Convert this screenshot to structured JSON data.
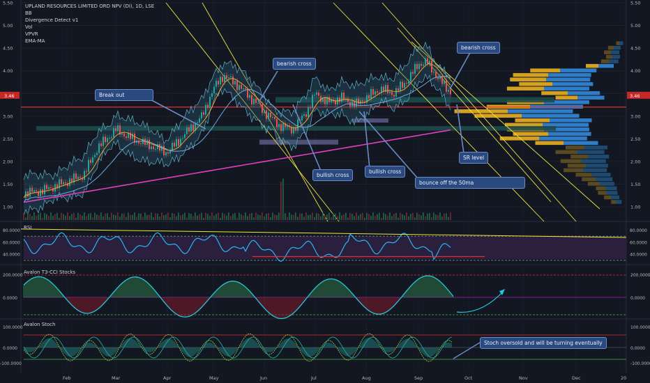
{
  "header": {
    "title": "UPLAND RESOURCES LIMITED ORD NPV (DI), 1D, LSE",
    "indicators": [
      "BB",
      "Divergence Detect v1",
      "Vol",
      "VPVR",
      "EMA-MA"
    ]
  },
  "panels": {
    "rsi_title": "RSI",
    "t3_title": "Avalon T3-CCI Stocks",
    "stoch_title": "Avalon Stoch"
  },
  "annotations": [
    {
      "id": "break-out",
      "text": "Break out"
    },
    {
      "id": "bearish-cross-1",
      "text": "bearish cross"
    },
    {
      "id": "bearish-cross-2",
      "text": "bearish cross"
    },
    {
      "id": "bullish-cross-1",
      "text": "bullish cross"
    },
    {
      "id": "bullish-cross-2",
      "text": "bullish cross"
    },
    {
      "id": "bounce-50ma",
      "text": "bounce off the 50ma"
    },
    {
      "id": "sr-level",
      "text": "SR level"
    },
    {
      "id": "stoch-note",
      "text": "Stoch oversold and will be turning eventually"
    }
  ],
  "colors": {
    "background": "#131722",
    "price_line": "#d1d4dc",
    "up_candle": "#26a69a",
    "down_candle": "#ef5350",
    "trend_yellow": "#f0e442",
    "ma_magenta": "#e040c0",
    "ema_orange": "#f0a030",
    "ma_blue": "#6fa8dc",
    "support_red": "#e03030",
    "rsi_line": "#29b6f6",
    "note_fill": "#2a4a7f"
  },
  "chart_data": {
    "type": "line",
    "x_ticks": [
      "Feb",
      "Mar",
      "Apr",
      "May",
      "Jun",
      "Jul",
      "Aug",
      "Sep",
      "Oct",
      "Nov",
      "Dec",
      "20"
    ],
    "price_axis": {
      "ticks": [
        "5.50",
        "5.00",
        "4.50",
        "4.00",
        "3.50",
        "3.00",
        "2.50",
        "2.00",
        "1.50",
        "1.00"
      ],
      "current_label": "3.46",
      "ylim": [
        0.8,
        5.5
      ]
    },
    "price_series": {
      "x": [
        "Jan",
        "Feb",
        "Mar",
        "Apr",
        "May",
        "Jun",
        "Jul",
        "Aug",
        "Sep",
        "mid-Sep"
      ],
      "values": [
        1.3,
        1.6,
        2.4,
        2.2,
        3.9,
        2.9,
        3.4,
        3.3,
        4.1,
        3.5
      ]
    },
    "levels": {
      "support_red": 3.2,
      "sr_band_high": 3.42,
      "sr_band_low": 2.75
    },
    "rsi_axis": {
      "ticks": [
        "80.0000",
        "60.0000",
        "40.0000"
      ]
    },
    "t3_axis": {
      "ticks": [
        "200.0000",
        "0.0000"
      ]
    },
    "stoch_axis": {
      "ticks": [
        "100.0000",
        "0.0000",
        "-100.0000"
      ]
    }
  }
}
